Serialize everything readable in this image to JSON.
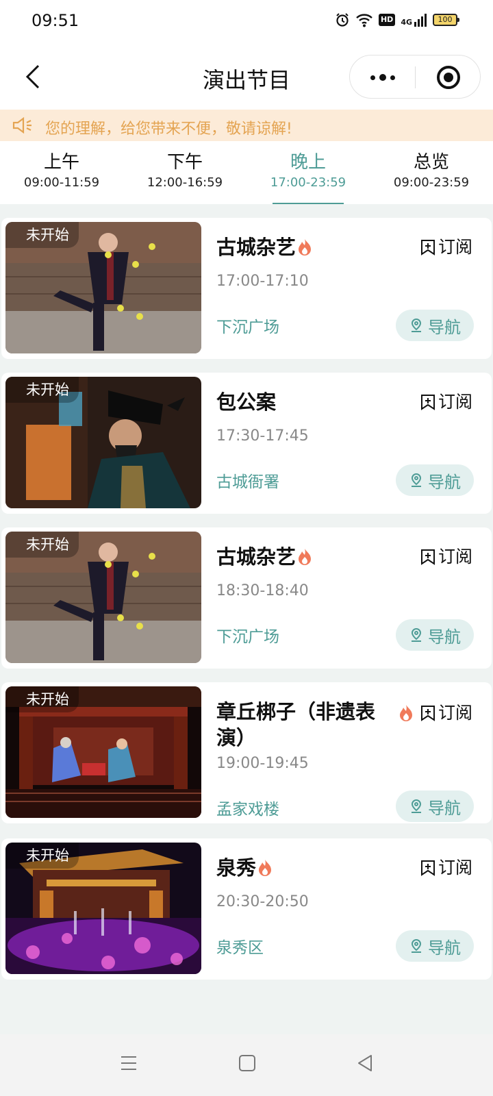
{
  "status_bar": {
    "time": "09:51",
    "hd_label": "HD",
    "network_label": "4G",
    "battery_label": "100"
  },
  "nav": {
    "title": "演出节目"
  },
  "notice": {
    "text": "您的理解，给您带来不便，敬请谅解!"
  },
  "tabs": [
    {
      "label": "上午",
      "range": "09:00-11:59"
    },
    {
      "label": "下午",
      "range": "12:00-16:59"
    },
    {
      "label": "晚上",
      "range": "17:00-23:59"
    },
    {
      "label": "总览",
      "range": "09:00-23:59"
    }
  ],
  "active_tab": 2,
  "accent_color": "#4e9c96",
  "notice_color": "#e4a452",
  "shows": [
    {
      "badge": "未开始",
      "title": "古城杂艺",
      "hot": true,
      "time": "17:00-17:10",
      "place": "下沉广场",
      "subscribe_label": "订阅",
      "navigate_label": "导航",
      "thumb": "juggler"
    },
    {
      "badge": "未开始",
      "title": "包公案",
      "hot": false,
      "time": "17:30-17:45",
      "place": "古城衙署",
      "subscribe_label": "订阅",
      "navigate_label": "导航",
      "thumb": "opera-actor"
    },
    {
      "badge": "未开始",
      "title": "古城杂艺",
      "hot": true,
      "time": "18:30-18:40",
      "place": "下沉广场",
      "subscribe_label": "订阅",
      "navigate_label": "导航",
      "thumb": "juggler"
    },
    {
      "badge": "未开始",
      "title": "章丘梆子（非遗表演）",
      "hot": true,
      "time": "19:00-19:45",
      "place": "孟家戏楼",
      "subscribe_label": "订阅",
      "navigate_label": "导航",
      "thumb": "stage"
    },
    {
      "badge": "未开始",
      "title": "泉秀",
      "hot": true,
      "time": "20:30-20:50",
      "place": "泉秀区",
      "subscribe_label": "订阅",
      "navigate_label": "导航",
      "thumb": "fountain-show"
    }
  ]
}
